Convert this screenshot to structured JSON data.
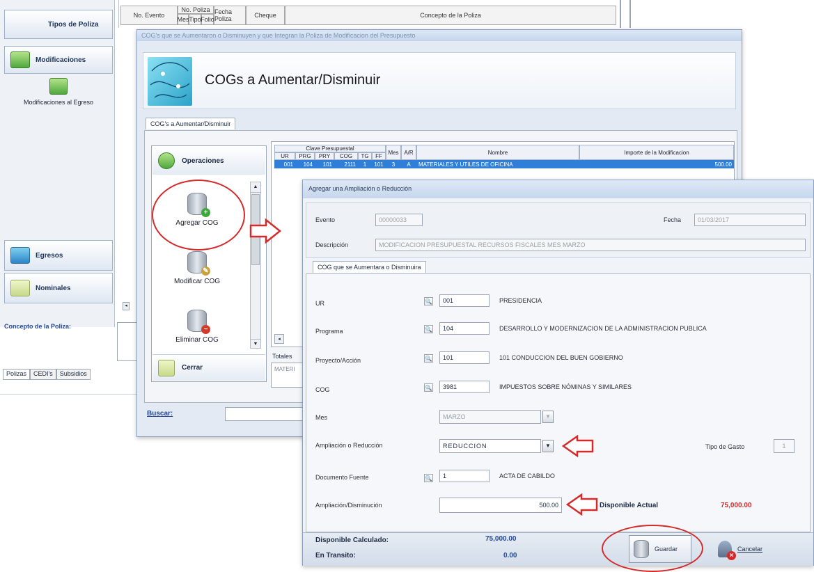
{
  "nav": {
    "tipos_poliza": "Tipos de Poliza",
    "modificaciones": "Modificaciones",
    "modificaciones_egreso": "Modificaciones al Egreso",
    "egresos": "Egresos",
    "nominales": "Nominales",
    "concepto_label": "Concepto de la Poliza:",
    "tabs": [
      "Polizas",
      "CEDI's",
      "Subsidios"
    ]
  },
  "bg_table": {
    "headers": [
      "No. Evento",
      "Mes",
      "Tipo",
      "Folio",
      "Fecha Poliza",
      "Cheque",
      "Concepto de la Poliza"
    ],
    "group": "No. Poliza"
  },
  "win1": {
    "title": "COG's que se Aumentaron o Disminuyen y que Integran la Poliza de Modificacion del Presupuesto",
    "heading": "COGs a Aumentar/Disminuir",
    "tab": "COG's a Aumentar/Disminuir",
    "operaciones": "Operaciones",
    "ops": [
      "Agregar COG",
      "Modificar COG",
      "Eliminar COG"
    ],
    "cerrar": "Cerrar",
    "grid_group": "Clave Presupuestal",
    "grid_headers": [
      "UR",
      "PRG",
      "PRY",
      "COG",
      "TG",
      "FF",
      "Mes",
      "A/R",
      "Nombre",
      "Importe de la Modificacion"
    ],
    "row": [
      "001",
      "104",
      "101",
      "2111",
      "1",
      "101",
      "3",
      "A",
      "MATERIALES Y UTILES DE OFICINA",
      "500.00"
    ],
    "totales": "Totales",
    "materiales": "MATERI",
    "buscar": "Buscar:"
  },
  "dlg": {
    "title": "Agregar una Ampliación o Reducción",
    "evento_label": "Evento",
    "evento_value": "00000033",
    "fecha_label": "Fecha",
    "fecha_value": "01/03/2017",
    "descripcion_label": "Descripción",
    "descripcion_value": "MODIFICACION PRESUPUESTAL RECURSOS FISCALES MES MARZO",
    "tab": "COG que se Aumentara o Disminuira",
    "ur_label": "UR",
    "ur_value": "001",
    "ur_desc": "PRESIDENCIA",
    "programa_label": "Programa",
    "programa_value": "104",
    "programa_desc": "DESARROLLO Y MODERNIZACION DE LA ADMINISTRACION PUBLICA",
    "proyecto_label": "Proyecto/Acción",
    "proyecto_value": "101",
    "proyecto_desc": "101 CONDUCCION DEL BUEN GOBIERNO",
    "cog_label": "COG",
    "cog_value": "3981",
    "cog_desc": "IMPUESTOS SOBRE NÓMINAS Y SIMILARES",
    "mes_label": "Mes",
    "mes_value": "MARZO",
    "amp_label": "Ampliación o Reducción",
    "amp_value": "REDUCCION",
    "tipo_gasto_label": "Tipo de Gasto",
    "tipo_gasto_value": "1",
    "doc_label": "Documento Fuente",
    "doc_value": "1",
    "doc_desc": "ACTA DE CABILDO",
    "ampdis_label": "Ampliación/Disminución",
    "ampdis_value": "500.00",
    "disp_actual_label": "Disponible Actual",
    "disp_actual_value": "75,000.00",
    "disp_calc_label": "Disponible Calculado:",
    "disp_calc_value": "75,000.00",
    "transito_label": "En Transito:",
    "transito_value": "0.00",
    "guardar": "Guardar",
    "cancelar": "Cancelar"
  },
  "colors": {
    "accent_red": "#d42a2a",
    "selection_blue": "#2f7fd8",
    "title_blue": "#c4d5ec"
  }
}
